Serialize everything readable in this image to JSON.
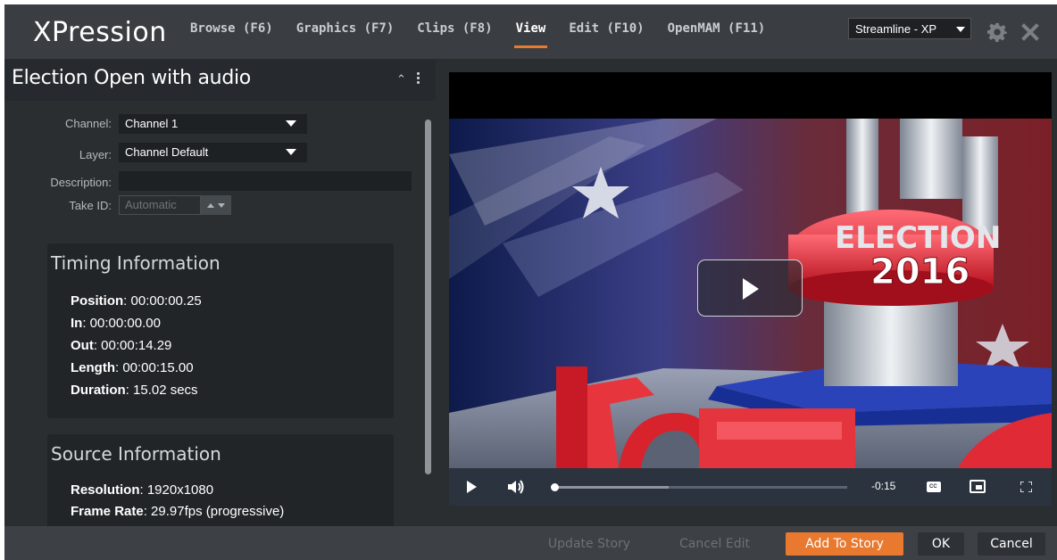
{
  "app": {
    "logo": "XPression",
    "nav": [
      {
        "label": "Browse (F6)",
        "active": false
      },
      {
        "label": "Graphics (F7)",
        "active": false
      },
      {
        "label": "Clips (F8)",
        "active": false
      },
      {
        "label": "View",
        "active": true
      },
      {
        "label": "Edit (F10)",
        "active": false
      },
      {
        "label": "OpenMAM (F11)",
        "active": false
      }
    ],
    "workspace_select": "Streamline - XP",
    "accent_color": "#e8792f"
  },
  "panel": {
    "title": "Election Open with audio",
    "fields": {
      "channel_label": "Channel:",
      "channel_value": "Channel 1",
      "layer_label": "Layer:",
      "layer_value": "Channel Default",
      "description_label": "Description:",
      "description_value": "",
      "takeid_label": "Take ID:",
      "takeid_placeholder": "Automatic"
    },
    "timing": {
      "title": "Timing Information",
      "rows": [
        {
          "label": "Position",
          "value": ": 00:00:00.25"
        },
        {
          "label": "In",
          "value": ": 00:00:00.00"
        },
        {
          "label": "Out",
          "value": ": 00:00:14.29"
        },
        {
          "label": "Length",
          "value": ": 00:00:15.00"
        },
        {
          "label": "Duration",
          "value": ": 15.02 secs"
        }
      ]
    },
    "source": {
      "title": "Source Information",
      "rows": [
        {
          "label": "Resolution",
          "value": ": 1920x1080"
        },
        {
          "label": "Frame Rate",
          "value": ": 29.97fps (progressive)"
        }
      ]
    }
  },
  "video": {
    "headline_top": "ELECTION",
    "headline_year": "2016",
    "time_remaining": "-0:15",
    "progress_played_fraction": 0.0,
    "progress_loaded_fraction": 0.39,
    "cc_label": "CC"
  },
  "footer": {
    "update_story": "Update Story",
    "cancel_edit": "Cancel Edit",
    "add_to_story": "Add To Story",
    "ok": "OK",
    "cancel": "Cancel"
  }
}
